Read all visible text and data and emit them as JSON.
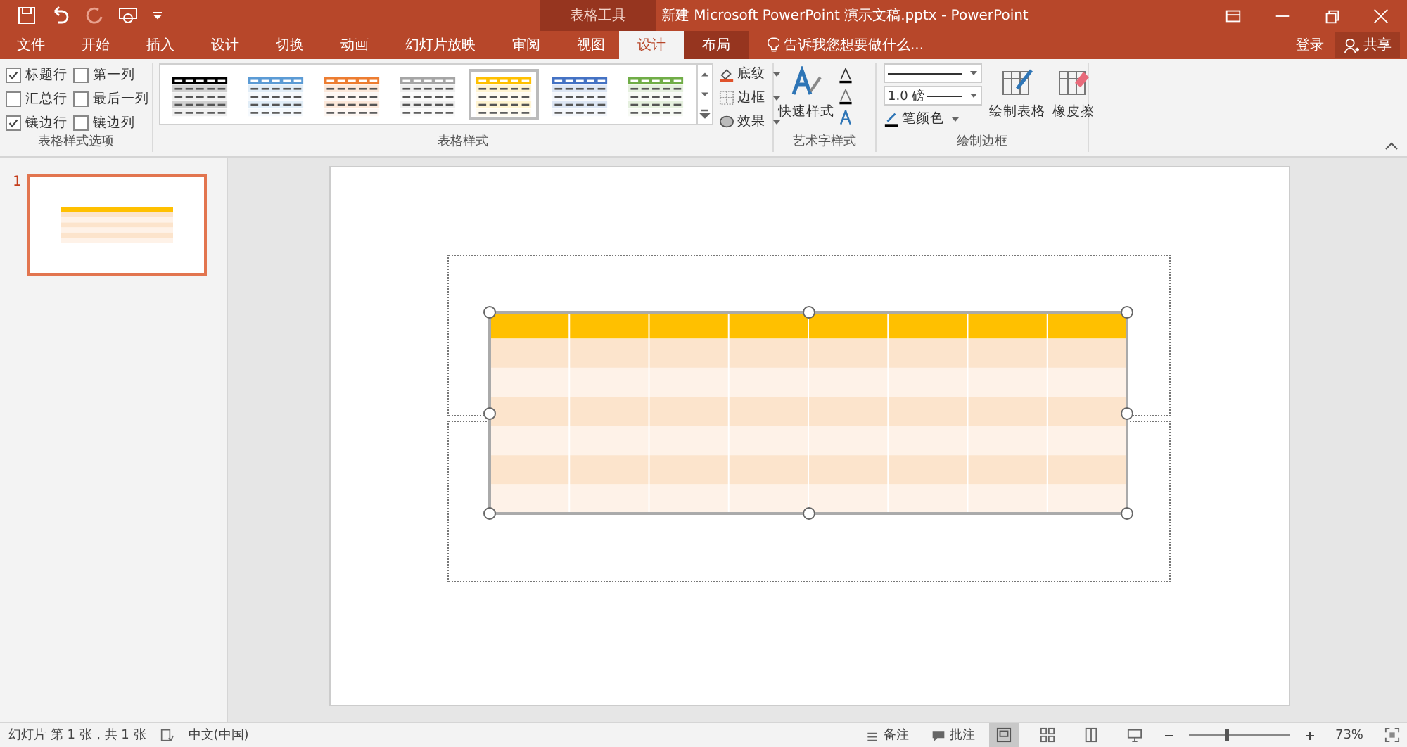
{
  "title_bar": {
    "context_tab": "表格工具",
    "title": "新建 Microsoft PowerPoint 演示文稿.pptx - PowerPoint"
  },
  "tabs": [
    {
      "label": "文件",
      "selected": false,
      "contextual": false
    },
    {
      "label": "开始",
      "selected": false,
      "contextual": false
    },
    {
      "label": "插入",
      "selected": false,
      "contextual": false
    },
    {
      "label": "设计",
      "selected": false,
      "contextual": false
    },
    {
      "label": "切换",
      "selected": false,
      "contextual": false
    },
    {
      "label": "动画",
      "selected": false,
      "contextual": false
    },
    {
      "label": "幻灯片放映",
      "selected": false,
      "contextual": false
    },
    {
      "label": "审阅",
      "selected": false,
      "contextual": false
    },
    {
      "label": "视图",
      "selected": false,
      "contextual": false
    },
    {
      "label": "设计",
      "selected": true,
      "contextual": true
    },
    {
      "label": "布局",
      "selected": false,
      "contextual": true
    }
  ],
  "tell_me": {
    "placeholder": "告诉我您想要做什么..."
  },
  "account": {
    "sign_in": "登录",
    "share": "共享"
  },
  "ribbon": {
    "style_options": {
      "label": "表格样式选项",
      "checkboxes": [
        {
          "label": "标题行",
          "checked": true
        },
        {
          "label": "第一列",
          "checked": false
        },
        {
          "label": "汇总行",
          "checked": false
        },
        {
          "label": "最后一列",
          "checked": false
        },
        {
          "label": "镶边行",
          "checked": true
        },
        {
          "label": "镶边列",
          "checked": false
        }
      ]
    },
    "table_styles": {
      "label": "表格样式",
      "styles": [
        {
          "color": "#000000",
          "selected": false
        },
        {
          "color": "#5b9bd5",
          "selected": false
        },
        {
          "color": "#ed7d31",
          "selected": false
        },
        {
          "color": "#a5a5a5",
          "selected": false
        },
        {
          "color": "#ffc000",
          "selected": true
        },
        {
          "color": "#4472c4",
          "selected": false
        },
        {
          "color": "#70ad47",
          "selected": false
        }
      ],
      "commands": [
        "底纹",
        "边框",
        "效果"
      ]
    },
    "wordart": {
      "label": "艺术字样式",
      "quick_styles": "快速样式"
    },
    "draw_borders": {
      "label": "绘制边框",
      "weight": "1.0 磅",
      "pen_color": "笔颜色",
      "draw_table": "绘制表格",
      "eraser": "橡皮擦"
    }
  },
  "thumbnails": [
    {
      "number": "1",
      "selected": true
    }
  ],
  "status_bar": {
    "slide_info": "幻灯片 第 1 张，共 1 张",
    "language": "中文(中国)",
    "notes": "备注",
    "comments": "批注",
    "zoom": {
      "level": 0.38,
      "reading": "73%"
    }
  }
}
